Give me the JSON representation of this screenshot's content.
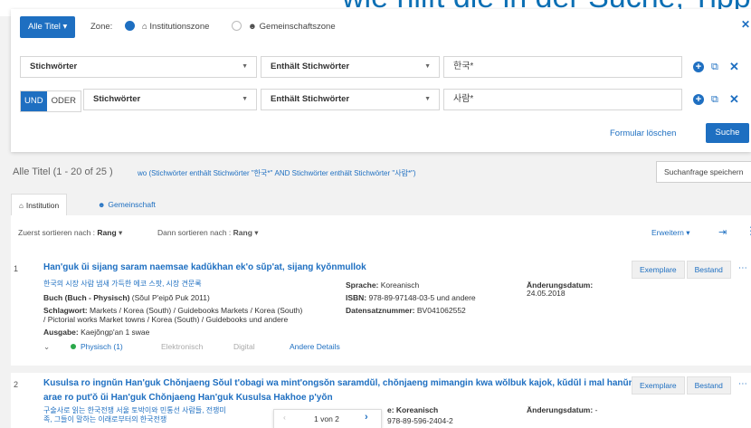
{
  "top_banner_text": "wie hilft die in der Suche, Tipps und",
  "search": {
    "scope_button": "Alle Titel",
    "scope_caret": "▾",
    "zone_label": "Zone:",
    "zone_institution": "Institutionszone",
    "zone_community": "Gemeinschaftszone",
    "rows": [
      {
        "field": "Stichwörter",
        "operator": "Enthält Stichwörter",
        "term": "한국*"
      },
      {
        "field": "Stichwörter",
        "operator": "Enthält Stichwörter",
        "term": "사람*"
      }
    ],
    "bool_and": "UND",
    "bool_or": "ODER",
    "clear_label": "Formular löschen",
    "search_label": "Suche"
  },
  "results": {
    "count_label": "Alle Titel (1 - 20 of 25 )",
    "query_text": "wo (Stichwörter enthält Stichwörter \"한국*\" AND Stichwörter enthält Stichwörter \"사람*\")",
    "save_query": "Suchanfrage speichern",
    "tab_institution": "Institution",
    "tab_community": "Gemeinschaft",
    "sort1_label": "Zuerst sortieren nach :",
    "sort1_value": "Rang",
    "sort2_label": "Dann sortieren nach :",
    "sort2_value": "Rang",
    "expand_label": "Erweitern ▾",
    "records": [
      {
        "num": "1",
        "title": "Han'guk ŭi sijang saram naemsae kadŭkhan ek'o sŭp'at, sijang kyŏnmullok",
        "subtitle": "한국의 시장 사람 냄새 가득한 에코 스팟, 시장 견문록",
        "type_line_bold": "Buch (Buch - Physisch)",
        "type_line_rest": " (Sŏul P'eipŏ Puk 2011)",
        "subject_bold": "Schlagwort:",
        "subject_text_1": " Markets / Korea (South) / Guidebooks Markets / Korea (South)",
        "subject_text_2": "/ Pictorial works Market towns / Korea (South) / Guidebooks und andere",
        "edition_bold": "Ausgabe:",
        "edition_text": " Kaejŏngp'an 1 swae",
        "language_bold": "Sprache:",
        "language_text": " Koreanisch",
        "isbn_bold": "ISBN:",
        "isbn_text": " 978-89-97148-03-5 und andere",
        "recnum_bold": "Datensatznummer:",
        "recnum_text": " BV041062552",
        "changed_label": "Änderungsdatum:",
        "changed_value": "24.05.2018",
        "avail_physical": "Physisch (1)",
        "avail_electronic": "Elektronisch",
        "avail_digital": "Digital",
        "avail_details": "Andere Details",
        "btn_copies": "Exemplare",
        "btn_holdings": "Bestand"
      },
      {
        "num": "2",
        "title_line1": "Kusulsa ro ingnŭn Han'guk Chŏnjaeng Sŏul t'obagi wa mint'ongsŏn saramdŭl, chŏnjaeng mimangin kwa wŏlbuk kajok, kŭdŭl i mal hanŭn",
        "title_line2": "arae ro put'ŏ ŭi Han'guk Chŏnjaeng Han'guk Kusulsa Hakhoe p'yŏn",
        "subtitle_line1": "구술사로 읽는 한국전쟁 서울 토박이와 민통선 사람들, 전쟁미",
        "subtitle_line2": "족, 그들이 말하는 이래로부터의 한국전쟁",
        "language_text": "e: Koreanisch",
        "isbn_text": "978-89-596-2404-2",
        "changed_label": "Änderungsdatum:",
        "changed_value": "-",
        "btn_copies": "Exemplare",
        "btn_holdings": "Bestand"
      }
    ],
    "pager_label": "1 von 2"
  }
}
